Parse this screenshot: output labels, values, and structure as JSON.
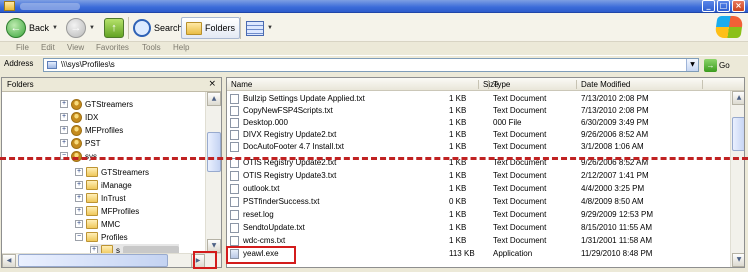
{
  "window": {
    "title": "",
    "controls": [
      "_",
      "□",
      "×"
    ]
  },
  "toolbar": {
    "back_label": "Back",
    "search_label": "Search",
    "folders_label": "Folders"
  },
  "menu": [
    "File",
    "Edit",
    "View",
    "Favorites",
    "Tools",
    "Help"
  ],
  "address": {
    "label": "Address",
    "path": "\\\\\\sys\\Profiles\\s",
    "go_label": "Go"
  },
  "folders_pane": {
    "title": "Folders",
    "close": "×",
    "tree": [
      {
        "label": "GTStreamers",
        "icon": "user-folder-icon"
      },
      {
        "label": "IDX",
        "icon": "user-folder-icon"
      },
      {
        "label": "MFProfiles",
        "icon": "user-folder-icon"
      },
      {
        "label": "PST",
        "icon": "user-folder-icon"
      },
      {
        "label": "sys",
        "icon": "user-folder-icon"
      },
      {
        "label": "GTStreamers",
        "icon": "folder-icon"
      },
      {
        "label": "iManage",
        "icon": "folder-icon"
      },
      {
        "label": "InTrust",
        "icon": "folder-icon"
      },
      {
        "label": "MFProfiles",
        "icon": "folder-icon"
      },
      {
        "label": "MMC",
        "icon": "folder-icon"
      },
      {
        "label": "Profiles",
        "icon": "folder-icon"
      },
      {
        "label": "s",
        "icon": "folder-icon"
      }
    ]
  },
  "file_list": {
    "columns": [
      "Name",
      "Size",
      "Type",
      "Date Modified"
    ],
    "rows_top": [
      {
        "name": "Bullzip Settings Update Applied.txt",
        "size": "1 KB",
        "type": "Text Document",
        "date": "7/13/2010 2:08 PM"
      },
      {
        "name": "CopyNewFSP4Scripts.txt",
        "size": "1 KB",
        "type": "Text Document",
        "date": "7/13/2010 2:08 PM"
      },
      {
        "name": "Desktop.000",
        "size": "1 KB",
        "type": "000 File",
        "date": "6/30/2009 3:49 PM"
      },
      {
        "name": "DIVX Registry Update2.txt",
        "size": "1 KB",
        "type": "Text Document",
        "date": "9/26/2006 8:52 AM"
      },
      {
        "name": "DocAutoFooter 4.7 Install.txt",
        "size": "1 KB",
        "type": "Text Document",
        "date": "3/1/2008 1:06 AM"
      }
    ],
    "rows_bottom": [
      {
        "name": "OTIS Registry Update2.txt",
        "size": "1 KB",
        "type": "Text Document",
        "date": "9/26/2006 8:52 AM"
      },
      {
        "name": "OTIS Registry Update3.txt",
        "size": "1 KB",
        "type": "Text Document",
        "date": "2/12/2007 1:41 PM"
      },
      {
        "name": "outlook.txt",
        "size": "1 KB",
        "type": "Text Document",
        "date": "4/4/2000 3:25 PM"
      },
      {
        "name": "PSTfinderSuccess.txt",
        "size": "0 KB",
        "type": "Text Document",
        "date": "4/8/2009 8:50 AM"
      },
      {
        "name": "reset.log",
        "size": "1 KB",
        "type": "Text Document",
        "date": "9/29/2009 12:53 PM"
      },
      {
        "name": "SendtoUpdate.txt",
        "size": "1 KB",
        "type": "Text Document",
        "date": "8/15/2010 11:55 AM"
      },
      {
        "name": "wdc-cms.txt",
        "size": "1 KB",
        "type": "Text Document",
        "date": "1/31/2001 11:58 AM"
      },
      {
        "name": "yeawl.exe",
        "size": "113 KB",
        "type": "Application",
        "date": "11/29/2010 8:48 PM"
      }
    ]
  },
  "colors": {
    "highlight": "#D31C1C",
    "title_bar": "#3B6BD9",
    "tear_line": "#C02222"
  }
}
